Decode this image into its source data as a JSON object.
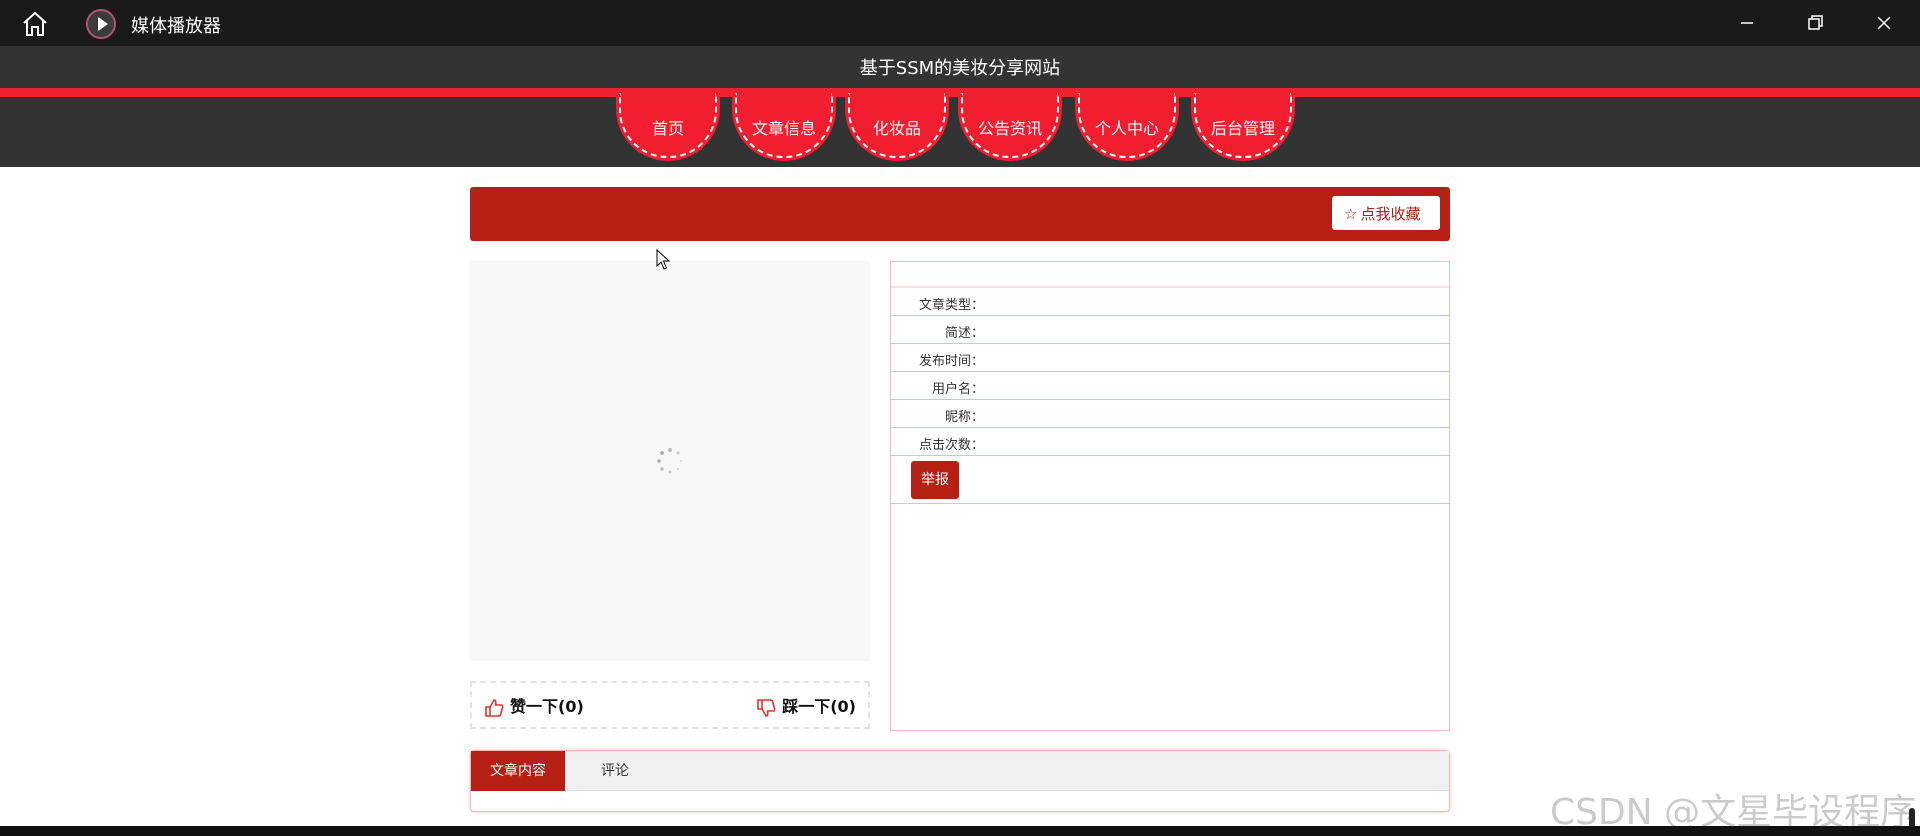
{
  "window": {
    "title": "媒体播放器"
  },
  "site": {
    "title": "基于SSM的美妆分享网站"
  },
  "nav": [
    {
      "label": "首页"
    },
    {
      "label": "文章信息"
    },
    {
      "label": "化妆品"
    },
    {
      "label": "公告资讯"
    },
    {
      "label": "个人中心"
    },
    {
      "label": "后台管理"
    }
  ],
  "banner": {
    "fav_label": "点我收藏"
  },
  "votes": {
    "up": "赞一下(0)",
    "down": "踩一下(0)"
  },
  "info": {
    "rows": [
      {
        "label": "文章类型："
      },
      {
        "label": "简述："
      },
      {
        "label": "发布时间："
      },
      {
        "label": "用户名："
      },
      {
        "label": "昵称："
      },
      {
        "label": "点击次数："
      }
    ],
    "report_label": "举报"
  },
  "tabs": [
    {
      "label": "文章内容"
    },
    {
      "label": "评论"
    }
  ],
  "watermark": "CSDN @文星毕设程序",
  "colors": {
    "accent": "#b51f14",
    "nav_red": "#f21d2f",
    "header_dark": "#333333"
  }
}
